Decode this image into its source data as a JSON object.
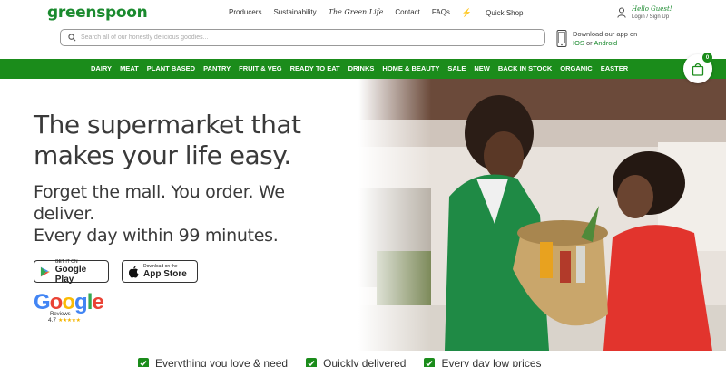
{
  "brand": {
    "logo_text": "greenspoon",
    "accent_color": "#1b8c1b"
  },
  "topnav": {
    "items": [
      "Producers",
      "Sustainability",
      "The Green Life",
      "Contact",
      "FAQs"
    ],
    "quick_shop": "Quick Shop"
  },
  "account": {
    "greeting": "Hello Guest!",
    "login_label": "Login / Sign Up",
    "icon": "user-icon"
  },
  "search": {
    "placeholder": "Search all of our honestly delicious goodies...",
    "value": ""
  },
  "app_download": {
    "line1": "Download our app on",
    "ios": "IOS",
    "or": "or",
    "android": "Android"
  },
  "categories": [
    "DAIRY",
    "MEAT",
    "PLANT BASED",
    "PANTRY",
    "FRUIT & VEG",
    "READY TO EAT",
    "DRINKS",
    "HOME & BEAUTY",
    "SALE",
    "NEW",
    "BACK IN STOCK",
    "ORGANIC",
    "EASTER"
  ],
  "cart": {
    "count": "0",
    "icon": "shopping-bag-icon"
  },
  "hero": {
    "headline": "The supermarket that makes your life easy.",
    "subline_1": "Forget the mall. You order. We deliver.",
    "subline_2": "Every day within 99 minutes."
  },
  "stores": {
    "google_play": {
      "small": "GET IT ON",
      "big": "Google Play"
    },
    "app_store": {
      "small": "Download on the",
      "big": "App Store"
    }
  },
  "google_reviews": {
    "word": "Google",
    "label": "Reviews",
    "rating": "4.7",
    "stars": "★★★★★"
  },
  "features": [
    "Everything you love & need",
    "Quickly delivered",
    "Every day low prices"
  ]
}
